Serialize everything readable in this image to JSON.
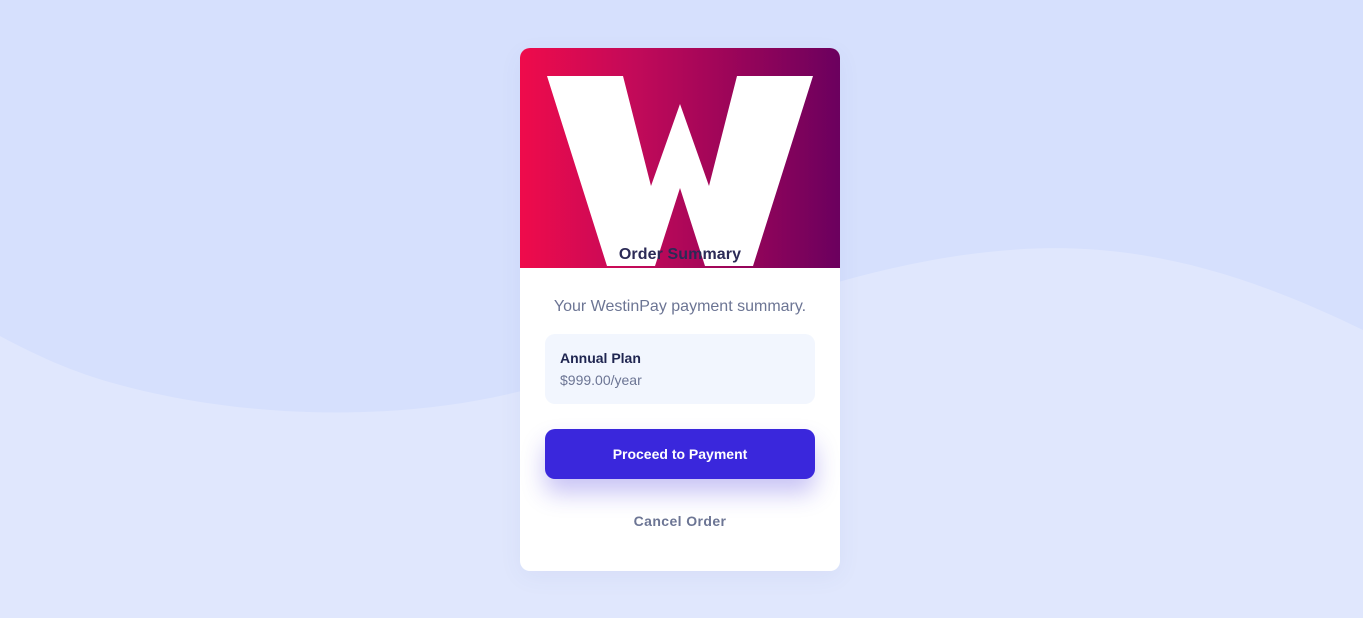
{
  "background": {
    "base_color": "#e0e7fd",
    "wave_color": "#d6e0fd"
  },
  "card": {
    "logo": {
      "icon": "westinpay-w-logo-icon",
      "letter": "W",
      "gradient_start": "#ef0b4b",
      "gradient_end": "#6b005e"
    },
    "heading": "Order Summary",
    "intro": "Your WestinPay payment summary.",
    "plan": {
      "name": "Annual Plan",
      "price": "$999.00/year"
    },
    "primary_action": {
      "label": "Proceed to Payment",
      "color": "#3a27dc"
    },
    "secondary_action": {
      "label": "Cancel Order"
    }
  }
}
